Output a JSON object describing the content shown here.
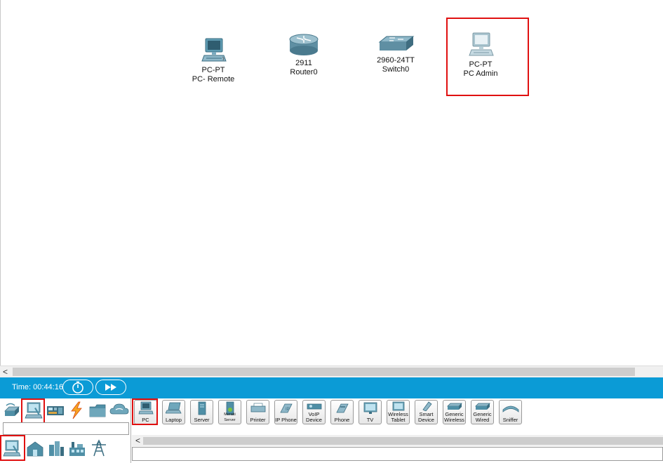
{
  "workspace": {
    "devices": [
      {
        "id": "pc-remote",
        "icon": "pc-icon",
        "model": "PC-PT",
        "name": "PC- Remote"
      },
      {
        "id": "router0",
        "icon": "router-icon",
        "model": "2911",
        "name": "Router0"
      },
      {
        "id": "switch0",
        "icon": "switch-icon",
        "model": "2960-24TT",
        "name": "Switch0"
      },
      {
        "id": "pc-admin",
        "icon": "pc-icon",
        "model": "PC-PT",
        "name": "PC Admin",
        "selected": true
      }
    ]
  },
  "scrollbar": {
    "left_arrow": "<"
  },
  "timebar": {
    "time_label": "Time: 00:44:16",
    "realtime_icon": "stopwatch-icon",
    "fast_forward_icon": "fast-forward-icon",
    "background_color": "#0b9bd6"
  },
  "categories": {
    "top_row": [
      {
        "icon": "network-devices-icon"
      },
      {
        "icon": "end-devices-icon",
        "selected": true
      },
      {
        "icon": "components-icon"
      },
      {
        "icon": "connections-icon"
      },
      {
        "icon": "miscellaneous-icon"
      },
      {
        "icon": "multiuser-icon"
      }
    ],
    "bottom_row": [
      {
        "icon": "end-devices-subcategory-icon",
        "selected": true
      },
      {
        "icon": "home-icon"
      },
      {
        "icon": "smart-city-icon"
      },
      {
        "icon": "industrial-icon"
      },
      {
        "icon": "power-grid-icon"
      }
    ]
  },
  "device_palette": {
    "items": [
      {
        "label": "PC",
        "icon": "pc-icon",
        "selected": true
      },
      {
        "label": "Laptop",
        "icon": "laptop-icon"
      },
      {
        "label": "Server",
        "icon": "server-icon"
      },
      {
        "label": "Meraki Server",
        "icon": "meraki-server-icon"
      },
      {
        "label": "Printer",
        "icon": "printer-icon"
      },
      {
        "label": "IP Phone",
        "icon": "ip-phone-icon"
      },
      {
        "label": "VoIP Device",
        "icon": "voip-device-icon"
      },
      {
        "label": "Phone",
        "icon": "phone-icon"
      },
      {
        "label": "TV",
        "icon": "tv-icon"
      },
      {
        "label": "Wireless Tablet",
        "icon": "tablet-icon"
      },
      {
        "label": "Smart Device",
        "icon": "smart-device-icon"
      },
      {
        "label": "Generic Wireless",
        "icon": "generic-wireless-icon"
      },
      {
        "label": "Generic Wired",
        "icon": "generic-wired-icon"
      },
      {
        "label": "Sniffer",
        "icon": "sniffer-icon"
      }
    ],
    "scroll_left_arrow": "<"
  },
  "colors": {
    "selection_red": "#e01010",
    "accent_blue": "#0b9bd6",
    "device_teal": "#4f8fa6"
  }
}
